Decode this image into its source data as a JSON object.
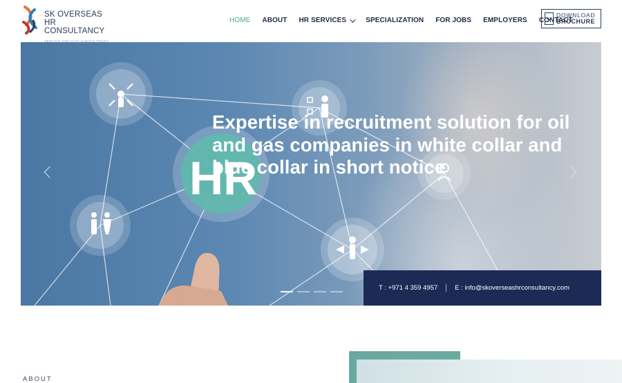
{
  "brand": {
    "name_line1": "SK OVERSEAS",
    "name_line2": "HR CONSULTANCY",
    "tagline": "Service you can always trust"
  },
  "nav": {
    "items": [
      {
        "label": "HOME",
        "active": true
      },
      {
        "label": "ABOUT"
      },
      {
        "label": "HR SERVICES",
        "has_dropdown": true
      },
      {
        "label": "SPECIALIZATION"
      },
      {
        "label": "FOR JOBS"
      },
      {
        "label": "EMPLOYERS"
      },
      {
        "label": "CONTACT"
      }
    ],
    "brochure_line1": "DOWNLOAD",
    "brochure_line2": "BROCHURE"
  },
  "hero": {
    "headline": "Expertise in recruitment solution for oil and gas companies in white collar and blue collar in short notice",
    "image_text": "HR",
    "slides_total": 4,
    "active_slide": 1
  },
  "contact": {
    "phone": "T : +971 4 359 4957",
    "email": "E : info@skoverseashrconsultancy.com"
  },
  "section": {
    "about_label": "ABOUT"
  },
  "colors": {
    "accent": "#4aa89a",
    "navy": "#1c2a55",
    "text": "#1f2a44"
  }
}
